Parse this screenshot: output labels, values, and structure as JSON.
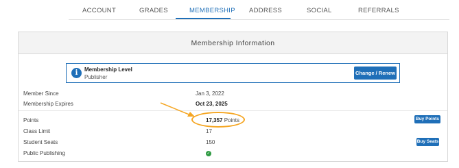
{
  "tabs": [
    {
      "label": "ACCOUNT"
    },
    {
      "label": "GRADES"
    },
    {
      "label": "MEMBERSHIP"
    },
    {
      "label": "ADDRESS"
    },
    {
      "label": "SOCIAL"
    },
    {
      "label": "REFERRALS"
    }
  ],
  "active_tab": "MEMBERSHIP",
  "panel": {
    "title": "Membership Information"
  },
  "membership_level": {
    "title": "Membership Level",
    "value": "Publisher",
    "icon": "info-icon",
    "change_label": "Change / Renew"
  },
  "rows": {
    "member_since": {
      "label": "Member Since",
      "value": "Jan 3, 2022"
    },
    "expires": {
      "label": "Membership Expires",
      "value": "Oct 23, 2025"
    },
    "points": {
      "label": "Points",
      "number": "17,357",
      "unit": "Points",
      "button": "Buy Points"
    },
    "class_limit": {
      "label": "Class Limit",
      "value": "17"
    },
    "student_seats": {
      "label": "Student Seats",
      "value": "150",
      "button": "Buy Seats"
    },
    "public_publishing": {
      "label": "Public Publishing",
      "icon": "check-icon",
      "status": "enabled"
    }
  },
  "colors": {
    "accent": "#1f6fb8",
    "highlight": "#f5a623",
    "success": "#2e9a42"
  }
}
